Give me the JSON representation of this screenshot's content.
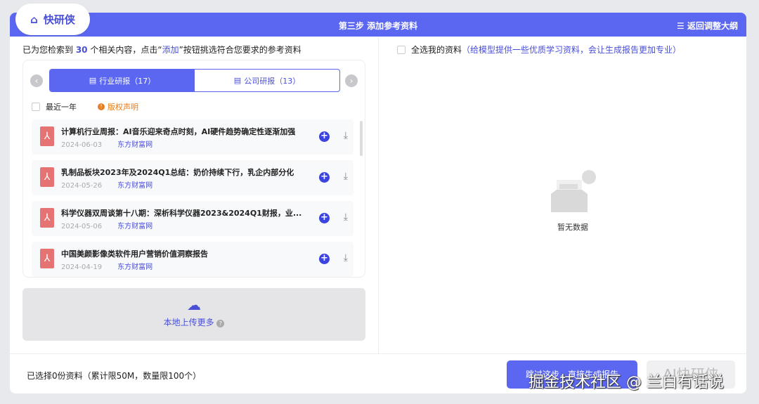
{
  "logo": {
    "text": "快研侠"
  },
  "header": {
    "step": "第三步 添加参考资料",
    "back": "返回调整大纲"
  },
  "hint": {
    "pre": "已为您检索到 ",
    "count": "30",
    "mid": " 个相关内容，点击“",
    "add": "添加",
    "post": "”按钮挑选符合您要求的参考资料"
  },
  "tabs": [
    {
      "label": "行业研报（17）"
    },
    {
      "label": "公司研报（13）"
    }
  ],
  "filters": {
    "recent": "最近一年",
    "copyright": "版权声明"
  },
  "items": [
    {
      "title": "计算机行业周报：AI音乐迎来奇点时刻，AI硬件趋势确定性逐渐加强",
      "date": "2024-06-03",
      "source": "东方财富网"
    },
    {
      "title": "乳制品板块2023年及2024Q1总结：奶价持续下行，乳企内部分化",
      "date": "2024-05-26",
      "source": "东方财富网"
    },
    {
      "title": "科学仪器双周谈第十八期：深析科学仪器2023&2024Q1财报，业...",
      "date": "2024-05-06",
      "source": "东方财富网"
    },
    {
      "title": "中国美颜影像类软件用户营销价值洞察报告",
      "date": "2024-04-19",
      "source": "东方财富网"
    }
  ],
  "upload": {
    "label": "本地上传更多"
  },
  "right": {
    "select_all": "全选我的资料",
    "select_note": "（给模型提供一些优质学习资料，会让生成报告更加专业）",
    "empty": "暂无数据"
  },
  "bottom": {
    "selected": "已选择0份资料（累计限50M，数量限100个）",
    "skip": "跳过这步，直接生成报告",
    "brand": "AI快研侠"
  },
  "watermark": "掘金技术社区 @ 兰白有话说"
}
